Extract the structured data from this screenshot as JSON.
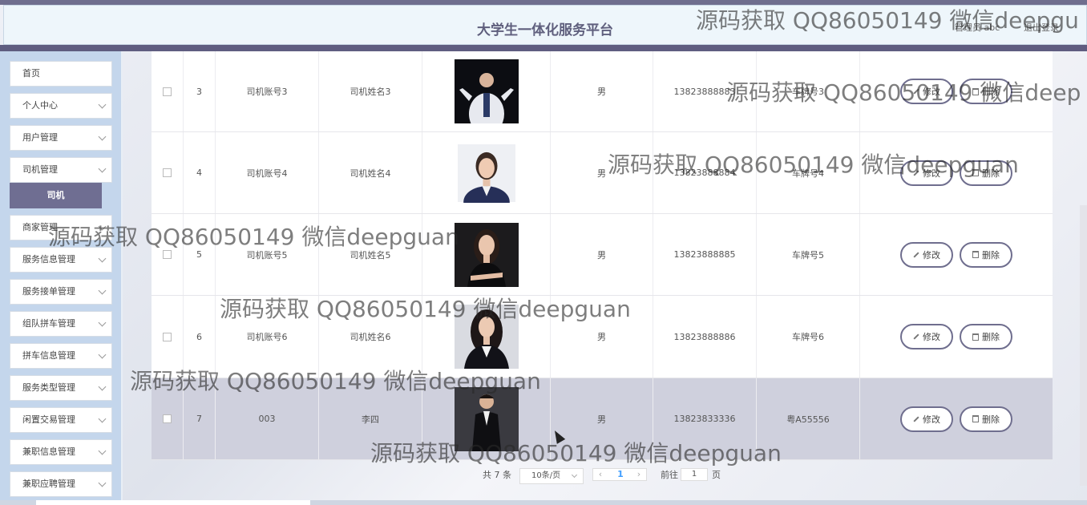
{
  "header": {
    "title": "大学生一体化服务平台",
    "user": "管理员 abc",
    "logout": "退出登录"
  },
  "sidebar": {
    "items": [
      {
        "label": "首页",
        "chevron": false
      },
      {
        "label": "个人中心",
        "chevron": true
      },
      {
        "label": "用户管理",
        "chevron": true
      },
      {
        "label": "司机管理",
        "chevron": true
      },
      {
        "label": "司机",
        "sub": true
      },
      {
        "label": "商家管理",
        "chevron": true
      },
      {
        "label": "服务信息管理",
        "chevron": true
      },
      {
        "label": "服务接单管理",
        "chevron": true
      },
      {
        "label": "组队拼车管理",
        "chevron": true
      },
      {
        "label": "拼车信息管理",
        "chevron": true
      },
      {
        "label": "服务类型管理",
        "chevron": true
      },
      {
        "label": "闲置交易管理",
        "chevron": true
      },
      {
        "label": "兼职信息管理",
        "chevron": true
      },
      {
        "label": "兼职应聘管理",
        "chevron": true
      }
    ]
  },
  "table": {
    "rows": [
      {
        "index": "3",
        "account": "司机账号3",
        "name": "司机姓名3",
        "gender": "男",
        "phone": "13823888883",
        "plate": "车牌号3",
        "photo": "man-white-suit"
      },
      {
        "index": "4",
        "account": "司机账号4",
        "name": "司机姓名4",
        "gender": "男",
        "phone": "13823888884",
        "plate": "车牌号4",
        "photo": "woman-navy-suit"
      },
      {
        "index": "5",
        "account": "司机账号5",
        "name": "司机姓名5",
        "gender": "男",
        "phone": "13823888885",
        "plate": "车牌号5",
        "photo": "woman-black-dress"
      },
      {
        "index": "6",
        "account": "司机账号6",
        "name": "司机姓名6",
        "gender": "男",
        "phone": "13823888886",
        "plate": "车牌号6",
        "photo": "woman-dark-blazer"
      },
      {
        "index": "7",
        "account": "003",
        "name": "李四",
        "gender": "男",
        "phone": "13823833336",
        "plate": "粤A55556",
        "photo": "man-black-suit"
      }
    ],
    "edit_label": "修改",
    "delete_label": "删除"
  },
  "pagination": {
    "total": "共 7 条",
    "page_size": "10条/页",
    "current_page": "1",
    "goto_label": "前往",
    "goto_value": "1",
    "page_suffix": "页"
  },
  "watermark": "源码获取 QQ86050149 微信deepguan",
  "watermark_short": "源码获取 QQ86050149 微信deepgu",
  "watermark_short2": "源码获取 QQ86050149 微信deep",
  "colors": {
    "accent": "#6f6e8e",
    "sidebar": "#c4d6ec",
    "highlight_row": "#cfd0dd"
  }
}
